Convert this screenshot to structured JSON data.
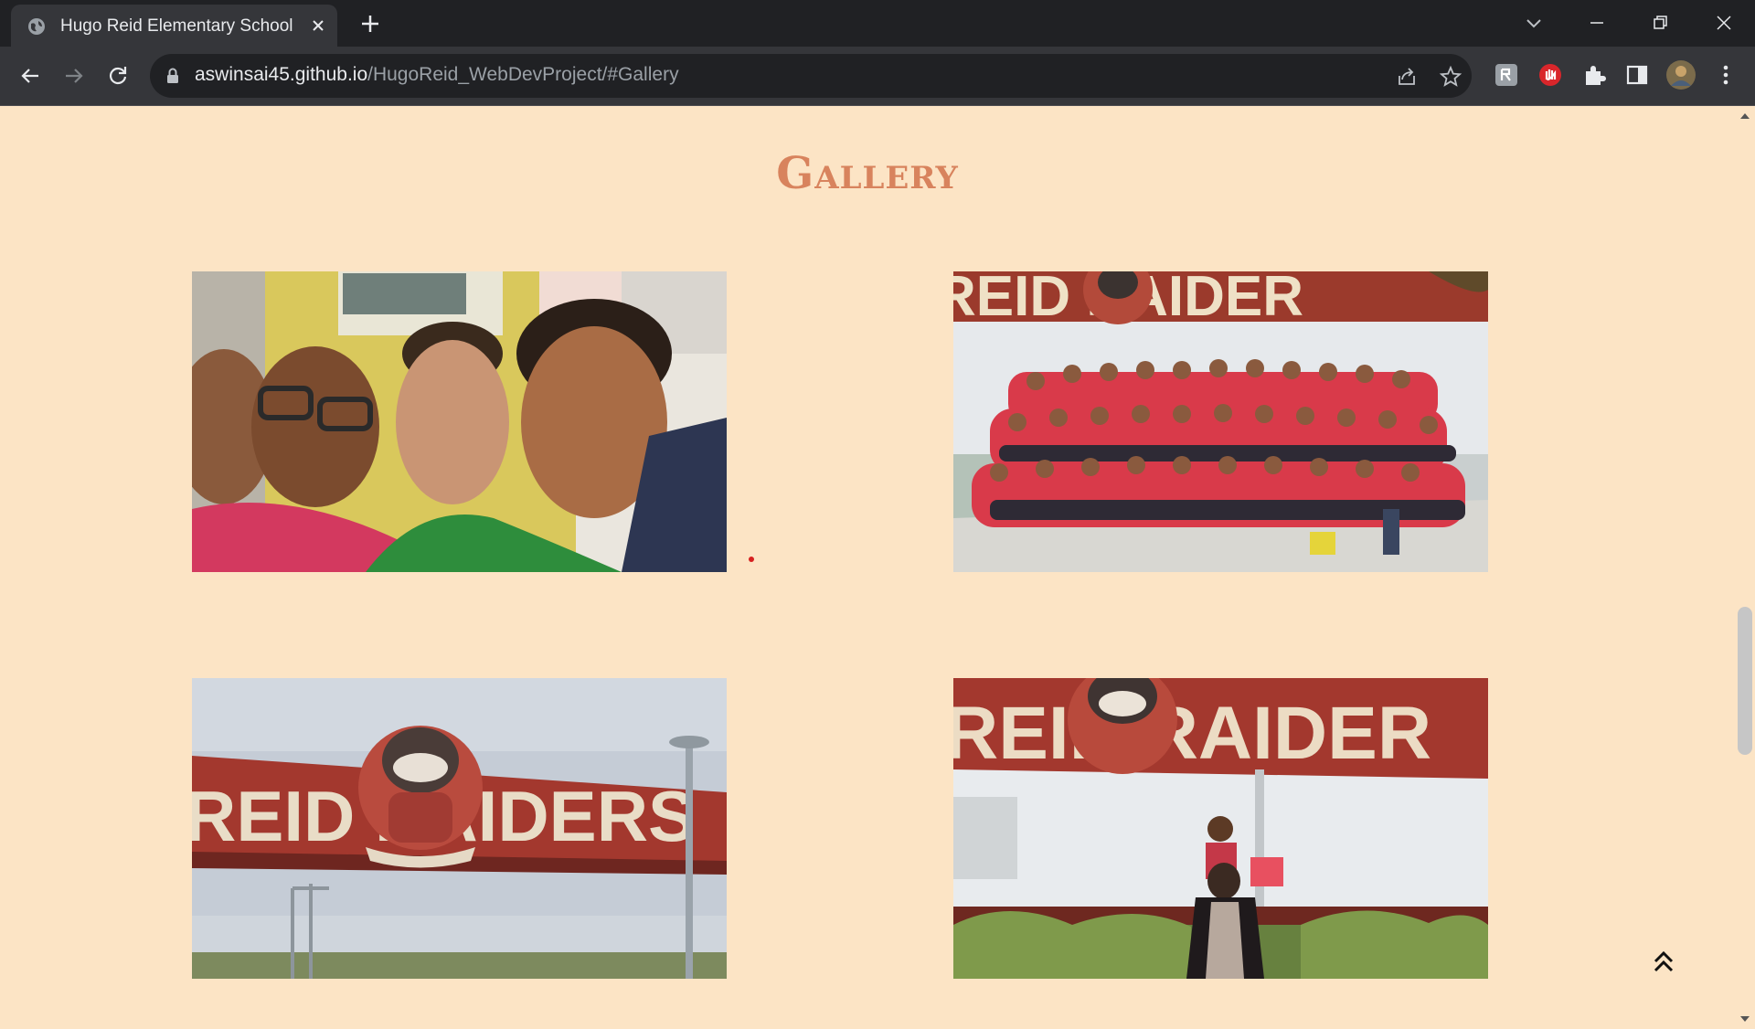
{
  "browser": {
    "tab_title": "Hugo Reid Elementary School",
    "url_host": "aswinsai45.github.io",
    "url_path": "/HugoReid_WebDevProject/#Gallery"
  },
  "page": {
    "section_title": "Gallery",
    "photos": [
      {
        "subject": "three smiling boys selfie"
      },
      {
        "subject": "class group photo in front of Reid Raiders mural"
      },
      {
        "subject": "Reid Raiders mural with raccoon mascot"
      },
      {
        "subject": "parent and child in front of Reid Raiders mural"
      }
    ]
  },
  "colors": {
    "page_background": "#fce4c5",
    "title_color": "#d8835d"
  }
}
